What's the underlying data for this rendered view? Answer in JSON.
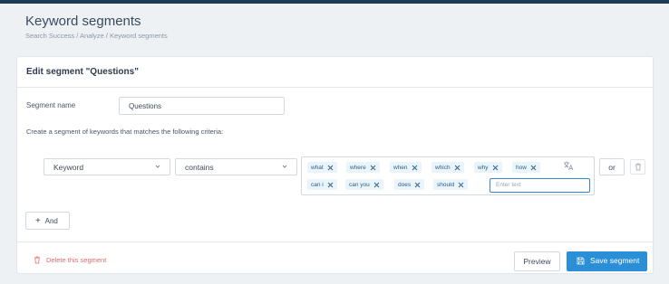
{
  "header": {
    "title": "Keyword segments",
    "breadcrumb": "Search Success / Analyze / Keyword segments"
  },
  "card": {
    "title": "Edit segment \"Questions\"",
    "segment_name_label": "Segment name",
    "segment_name_value": "Questions",
    "criteria_text": "Create a segment of keywords that matches the following criteria:"
  },
  "condition": {
    "field_value": "Keyword",
    "operator_value": "contains",
    "tags": [
      "what",
      "where",
      "when",
      "which",
      "why",
      "how",
      "can i",
      "can you",
      "does",
      "should"
    ],
    "tag_input_placeholder": "Enter text",
    "or_label": "or"
  },
  "and_button": {
    "label": "And"
  },
  "footer": {
    "delete_label": "Delete this segment",
    "preview_label": "Preview",
    "save_label": "Save segment"
  },
  "colors": {
    "accent": "#2a8fd6",
    "danger": "#e06a6a",
    "tag_bg": "#e9f4fb",
    "topbar": "#1f3a55"
  },
  "icons": {
    "tag_remove": "close-icon",
    "select_caret": "chevron-down-icon",
    "language": "language-icon",
    "trash": "trash-icon",
    "plus": "plus-icon",
    "save": "save-icon"
  }
}
